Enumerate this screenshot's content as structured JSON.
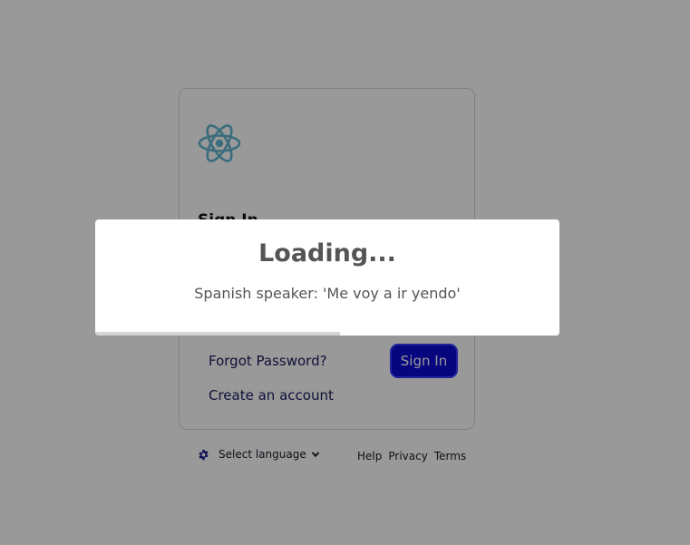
{
  "login": {
    "heading": "Sign In",
    "forgot_password": "Forgot Password?",
    "create_account": "Create an account",
    "sign_in_button": "Sign In"
  },
  "footer": {
    "language_label": "Select language",
    "links": [
      "Help",
      "Privacy",
      "Terms"
    ]
  },
  "loading": {
    "title": "Loading...",
    "message": "Spanish speaker: 'Me voy a ir yendo'",
    "progress": 0.527
  },
  "colors": {
    "logo": "#61b5cf",
    "primary_button": "#0a0ad4",
    "link": "#1a1a5e"
  },
  "icons": {
    "logo": "react-atom-icon",
    "settings": "gear-icon",
    "dropdown": "chevron-down-icon"
  }
}
